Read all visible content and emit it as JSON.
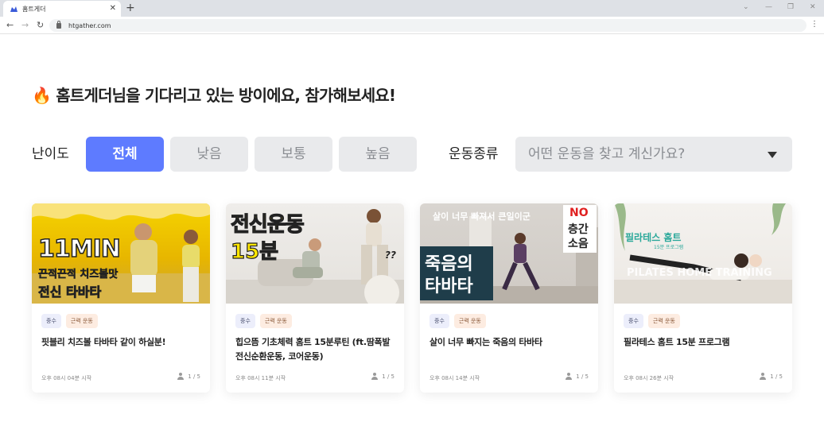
{
  "browser": {
    "tab_title": "홈트게더",
    "url": "htgather.com",
    "new_tab_label": "+",
    "close_label": "✕",
    "colors": {
      "tabbar": "#dee1e6",
      "favicon": "#3b5bd9"
    }
  },
  "page": {
    "headline_emoji": "🔥",
    "headline": "홈트게더님을 기다리고 있는 방이에요, 참가해보세요!",
    "filters": {
      "difficulty_label": "난이도",
      "difficulty_options": [
        "전체",
        "낮음",
        "보통",
        "높음"
      ],
      "selected_difficulty": "전체",
      "exercise_type_label": "운동종류",
      "exercise_type_placeholder": "어떤 운동을 찾고 계신가요?"
    },
    "colors": {
      "accent": "#5e7bff",
      "button_bg": "#e9eaec",
      "level_tag_bg": "#eceefb",
      "type_tag_bg": "#fdece1"
    },
    "cards": [
      {
        "thumb_text": [
          "11MIN",
          "끈적끈적 치즈볼맛",
          "전신 타바타"
        ],
        "thumb_colors": {
          "bg": "#f2c400"
        },
        "level_tag": "중수",
        "type_tag": "근력 운동",
        "title": "핏블리 치즈볼 타바타 같이 하실분!",
        "time": "오후 08시 04분 시작",
        "count": "1 / 5"
      },
      {
        "thumb_text": [
          "전신운동",
          "15분",
          "??"
        ],
        "thumb_colors": {
          "bg": "#e9e6e1"
        },
        "level_tag": "중수",
        "type_tag": "근력 운동",
        "title": "힙으뜸 기초체력 홈트 15분루틴 (ft.땀폭발 전신순환운동, 코어운동)",
        "time": "오후 08시 11분 시작",
        "count": "1 / 5"
      },
      {
        "thumb_text": [
          "살이 너무 빠져서 큰일이군",
          "NO",
          "층간",
          "소음",
          "죽음의",
          "타바타"
        ],
        "thumb_colors": {
          "bg": "#d8d4cf"
        },
        "level_tag": "중수",
        "type_tag": "근력 운동",
        "title": "살이 너무 빠지는 죽음의 타바타",
        "time": "오후 08시 14분 시작",
        "count": "1 / 5"
      },
      {
        "thumb_text": [
          "필라테스 홈트",
          "15분 프로그램",
          "PILATES HOME TRAINING"
        ],
        "thumb_colors": {
          "bg": "#f1efec"
        },
        "level_tag": "중수",
        "type_tag": "근력 운동",
        "title": "필라테스 홈트 15분 프로그램",
        "time": "오후 08시 26분 시작",
        "count": "1 / 5"
      }
    ]
  }
}
